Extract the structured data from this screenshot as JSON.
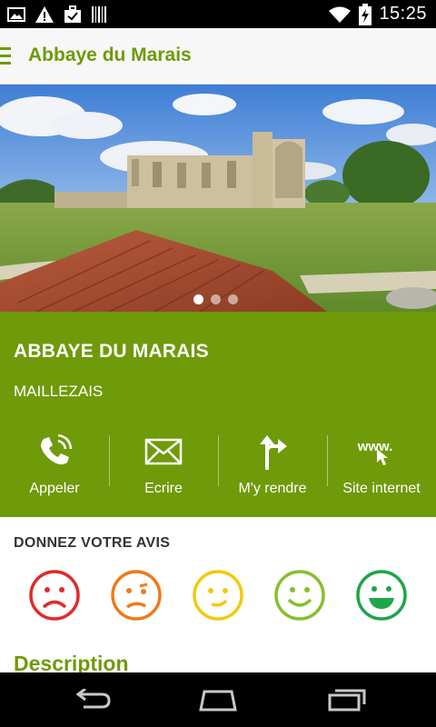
{
  "status_bar": {
    "time": "15:25",
    "icons": [
      "image-icon",
      "warning-icon",
      "briefcase-icon",
      "barcode-icon",
      "wifi-icon",
      "battery-charging-icon"
    ]
  },
  "app_bar": {
    "title": "Abbaye du Marais",
    "menu_icon": "hamburger-menu-icon"
  },
  "hero": {
    "carousel_dots": 3,
    "active_dot": 1
  },
  "place": {
    "name": "ABBAYE DU MARAIS",
    "city": "MAILLEZAIS"
  },
  "actions": [
    {
      "label": "Appeler",
      "icon": "phone-icon"
    },
    {
      "label": "Ecrire",
      "icon": "mail-icon"
    },
    {
      "label": "M'y rendre",
      "icon": "directions-icon"
    },
    {
      "label": "Site internet",
      "icon": "website-icon",
      "icon_text": "www."
    }
  ],
  "rating": {
    "title": "DONNEZ VOTRE AVIS",
    "faces": [
      {
        "mood": "very-unhappy",
        "color": "#e22a2a"
      },
      {
        "mood": "unhappy",
        "color": "#f07a1a"
      },
      {
        "mood": "neutral",
        "color": "#f3c80f"
      },
      {
        "mood": "happy",
        "color": "#86c02b"
      },
      {
        "mood": "very-happy",
        "color": "#1fa54a"
      }
    ]
  },
  "description": {
    "title": "Description"
  },
  "colors": {
    "brand_green": "#6f9a0a"
  }
}
